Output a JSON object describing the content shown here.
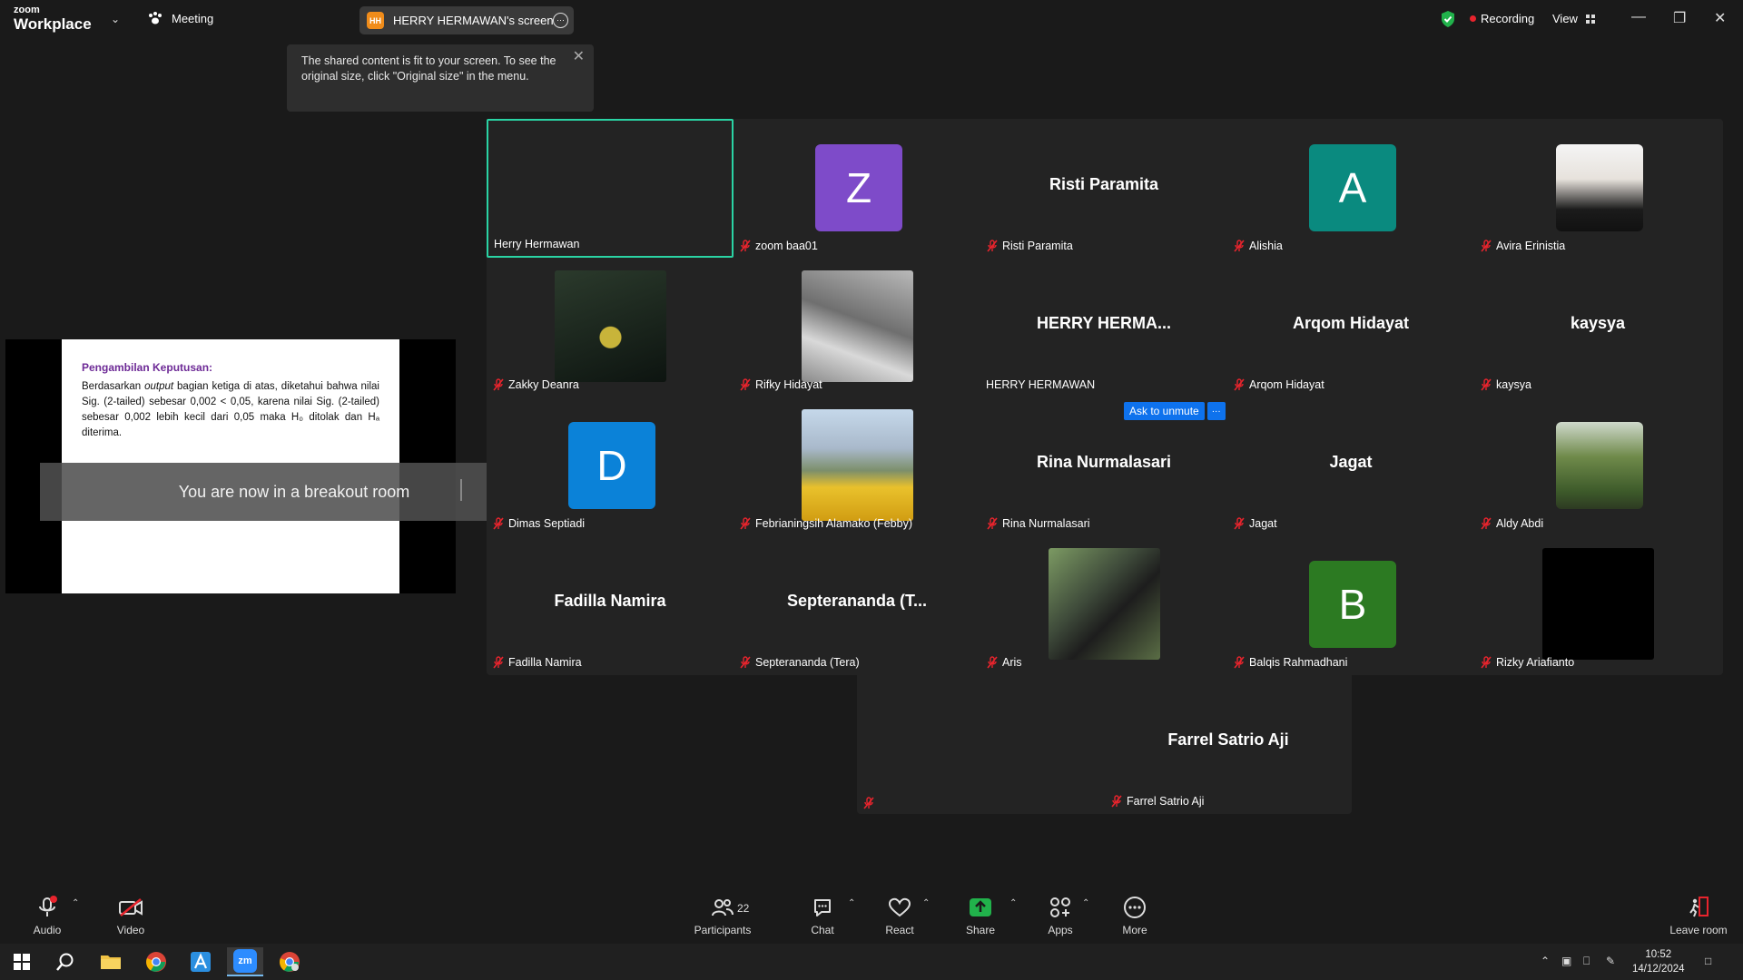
{
  "topbar": {
    "logo_small": "zoom",
    "logo_big": "Workplace",
    "meeting_label": "Meeting",
    "screen_label": "HERRY HERMAWAN's screen",
    "screen_initials": "HH",
    "recording_label": "Recording",
    "view_label": "View"
  },
  "tooltip": {
    "text": "The shared content is fit to your screen. To see the original size, click \"Original size\" in the menu."
  },
  "slide": {
    "heading": "Pengambilan Keputusan:",
    "body_pre": "Berdasarkan ",
    "body_italic": "output",
    "body_post": " bagian ketiga di atas, diketahui bahwa nilai Sig. (2-tailed) sebesar 0,002 < 0,05, karena nilai Sig. (2-tailed) sebesar 0,002 lebih kecil dari 0,05 maka H₀ ditolak dan Hₐ diterima."
  },
  "breakout": {
    "text": "You are now in a breakout room"
  },
  "participants": [
    {
      "name": "Herry Hermawan",
      "muted": false,
      "display": "video"
    },
    {
      "name": "zoom baa01",
      "muted": true,
      "display": "avatar",
      "letter": "Z",
      "color": "#7e4bc9"
    },
    {
      "name": "Risti Paramita",
      "muted": true,
      "display": "name",
      "big": "Risti Paramita"
    },
    {
      "name": "Alishia",
      "muted": true,
      "display": "avatar",
      "letter": "A",
      "color": "#0a8a7f"
    },
    {
      "name": "Avira Erinistia",
      "muted": true,
      "display": "photo"
    },
    {
      "name": "Zakky Deanra",
      "muted": true,
      "display": "photo"
    },
    {
      "name": "Rifky Hidayat",
      "muted": true,
      "display": "photo"
    },
    {
      "name": "HERRY HERMAWAN",
      "muted": false,
      "display": "name",
      "big": "HERRY  HERMA..."
    },
    {
      "name": "Arqom Hidayat",
      "muted": true,
      "display": "name",
      "big": "Arqom Hidayat"
    },
    {
      "name": "kaysya",
      "muted": true,
      "display": "name",
      "big": "kaysya"
    },
    {
      "name": "Dimas Septiadi",
      "muted": true,
      "display": "avatar",
      "letter": "D",
      "color": "#0b82d8"
    },
    {
      "name": "Febrianingsih Alamako (Febby)",
      "muted": true,
      "display": "photo"
    },
    {
      "name": "Rina Nurmalasari",
      "muted": true,
      "display": "name",
      "big": "Rina Nurmalasari"
    },
    {
      "name": "Jagat",
      "muted": true,
      "display": "name",
      "big": "Jagat"
    },
    {
      "name": "Aldy Abdi",
      "muted": true,
      "display": "photo"
    },
    {
      "name": "Fadilla Namira",
      "muted": true,
      "display": "name",
      "big": "Fadilla Namira"
    },
    {
      "name": "Septerananda (Tera)",
      "muted": true,
      "display": "name",
      "big": "Septerananda (T..."
    },
    {
      "name": "Aris",
      "muted": true,
      "display": "photo"
    },
    {
      "name": "Balqis Rahmadhani",
      "muted": true,
      "display": "avatar",
      "letter": "B",
      "color": "#2c7a22"
    },
    {
      "name": "Rizky Ariafianto",
      "muted": true,
      "display": "photo"
    },
    {
      "name": "Farrel Satrio Aji",
      "muted": true,
      "display": "name",
      "big": "Farrel Satrio Aji"
    }
  ],
  "ask_unmute": "Ask to unmute",
  "toolbar": {
    "audio": "Audio",
    "video": "Video",
    "participants": "Participants",
    "participant_count": "22",
    "chat": "Chat",
    "react": "React",
    "share": "Share",
    "apps": "Apps",
    "more": "More",
    "leave": "Leave room"
  },
  "taskbar": {
    "time": "10:52",
    "date": "14/12/2024",
    "zoom_icon_text": "zm"
  }
}
